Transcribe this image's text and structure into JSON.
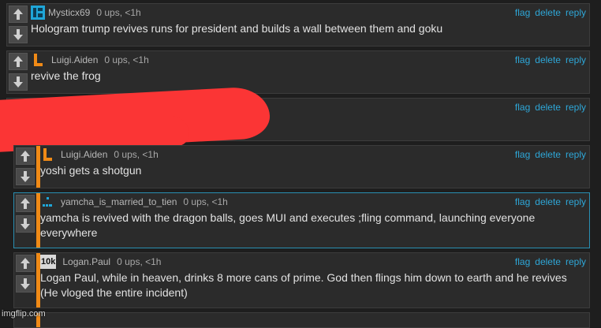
{
  "actions": {
    "flag": "flag",
    "delete": "delete",
    "reply": "reply"
  },
  "comments": [
    {
      "user": "Mysticx69",
      "meta": "0 ups, <1h",
      "text": "Hologram trump revives runs for president and builds a wall between them and goku"
    },
    {
      "user": "Luigi.Aiden",
      "meta": "0 ups, <1h",
      "text": "revive the frog"
    },
    {
      "user": "",
      "meta": "",
      "text": ""
    },
    {
      "user": "Luigi.Aiden",
      "meta": "0 ups, <1h",
      "text": "yoshi gets a shotgun"
    },
    {
      "user": "yamcha_is_married_to_tien",
      "meta": "0 ups, <1h",
      "text": "yamcha is revived with the dragon balls, goes MUI and executes ;fling command, launching everyone everywhere"
    },
    {
      "user": "Logan.Paul",
      "meta": "0 ups, <1h",
      "avatar_text": "10k",
      "text": "Logan Paul, while in heaven, drinks 8 more cans of prime. God then flings him down to earth and he revives (He vloged the entire incident)"
    }
  ],
  "watermark": "imgflip.com",
  "colors": {
    "accent_bar": "#f08a16",
    "link": "#2ea7d8",
    "redaction": "#fb3535"
  }
}
